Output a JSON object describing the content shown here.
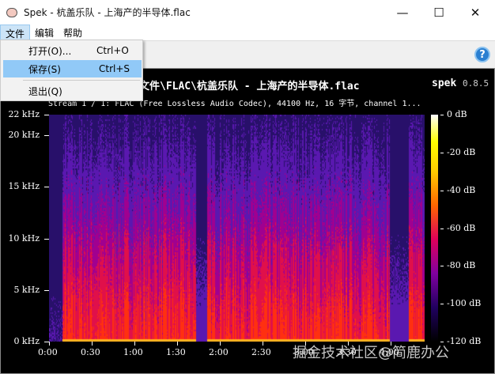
{
  "window": {
    "title": "Spek - 杭盖乐队 - 上海产的半导体.flac",
    "minimize": "—",
    "maximize": "☐",
    "close": "✕"
  },
  "menubar": {
    "items": [
      "文件",
      "编辑",
      "帮助"
    ]
  },
  "file_menu": {
    "items": [
      {
        "label": "打开(O)...",
        "shortcut": "Ctrl+O"
      },
      {
        "label": "保存(S)",
        "shortcut": "Ctrl+S"
      },
      {
        "label": "退出(Q)"
      }
    ]
  },
  "toolbar": {
    "help": "?"
  },
  "spectrogram": {
    "file_path": "文件\\FLAC\\杭盖乐队 - 上海产的半导体.flac",
    "app_name": "spek",
    "app_version": "0.8.5",
    "stream_info": "Stream 1 / 1: FLAC (Free Lossless Audio Codec), 44100 Hz, 16 字节, channel 1...",
    "freq_labels": [
      "22 kHz",
      "20 kHz",
      "15 kHz",
      "10 kHz",
      "5 kHz",
      "0 kHz"
    ],
    "freq_values": [
      22,
      20,
      15,
      10,
      5,
      0
    ],
    "time_labels": [
      "0:00",
      "0:30",
      "1:00",
      "1:30",
      "2:00",
      "2:30",
      "3:00",
      "3:30",
      "4:00"
    ],
    "db_labels": [
      "0 dB",
      "-20 dB",
      "-40 dB",
      "-60 dB",
      "-80 dB",
      "-100 dB",
      "-120 dB"
    ]
  },
  "watermark": "掘金技术社区@简鹿办公"
}
